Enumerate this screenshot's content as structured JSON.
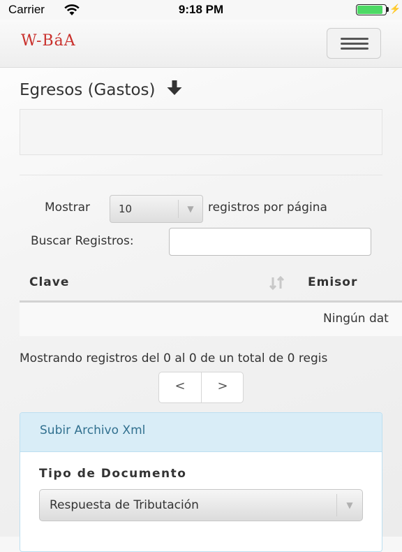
{
  "status_bar": {
    "carrier": "Carrier",
    "time": "9:18 PM",
    "battery_level": 0.95
  },
  "navbar": {
    "brand": "W-BáA",
    "menu_icon": "hamburger-menu-icon"
  },
  "page": {
    "title": "Egresos (Gastos)",
    "title_icon": "arrow-down-icon"
  },
  "table_controls": {
    "length_prefix": "Mostrar",
    "length_value": "10",
    "length_suffix": "registros por página",
    "search_label": "Buscar Registros:",
    "search_value": ""
  },
  "table": {
    "columns": [
      "Clave",
      "Emisor"
    ],
    "sort_icon": "sort-icon",
    "empty_message": "Ningún dat"
  },
  "footer": {
    "info": "Mostrando registros del 0 al 0 de un total de 0 regis",
    "pager_prev": "<",
    "pager_next": ">"
  },
  "upload_panel": {
    "heading": "Subir Archivo Xml",
    "field_label": "Tipo de Documento",
    "field_value": "Respuesta de Tributación"
  },
  "colors": {
    "brand": "#c9302c",
    "panel_heading_bg": "#d9edf7",
    "panel_heading_text": "#31708f",
    "battery": "#4cd964"
  }
}
